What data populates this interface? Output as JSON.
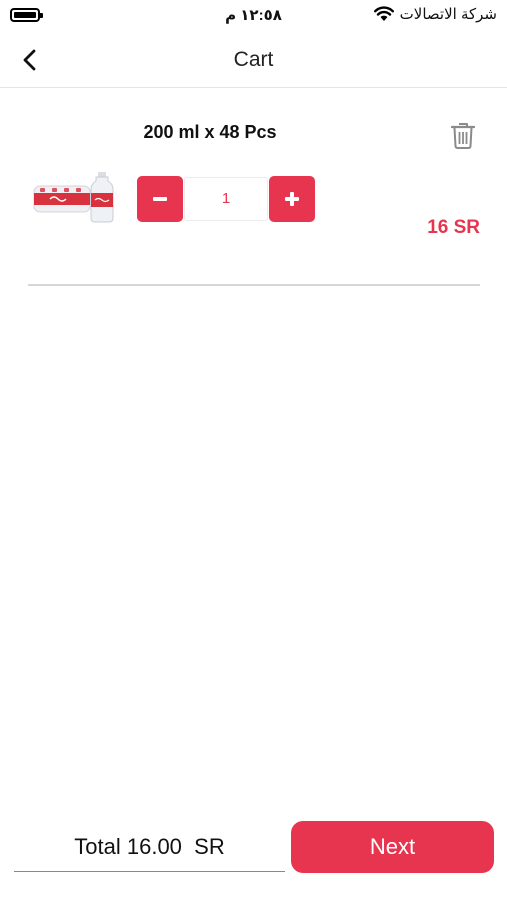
{
  "status_bar": {
    "time": "١٢:٥٨ م",
    "carrier": "شركة الاتصالات"
  },
  "header": {
    "title": "Cart",
    "back_icon": "chevron-left-icon"
  },
  "cart": {
    "items": [
      {
        "title": "200 ml x 48 Pcs",
        "quantity": "1",
        "price": "16 SR",
        "delete_icon": "trash-icon",
        "image": "water-bottle-pack-image"
      }
    ]
  },
  "footer": {
    "total": "Total 16.00  SR",
    "next_label": "Next"
  },
  "colors": {
    "accent": "#e8354f",
    "divider": "#d6d6d6"
  }
}
